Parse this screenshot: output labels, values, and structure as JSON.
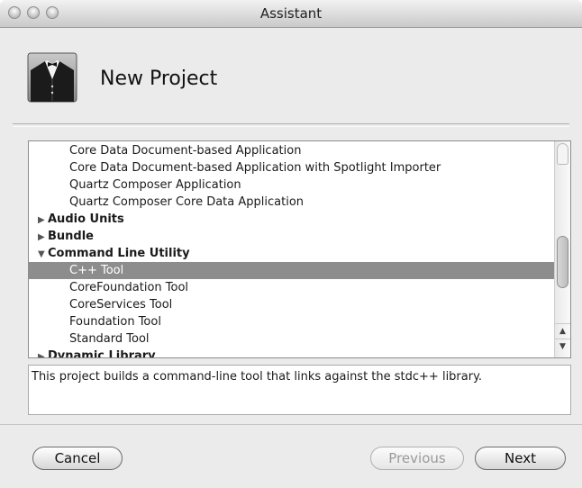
{
  "window": {
    "title": "Assistant"
  },
  "header": {
    "title": "New Project",
    "icon": "tuxedo-icon"
  },
  "list": {
    "items": [
      {
        "label": "Core Data Document-based Application",
        "kind": "child"
      },
      {
        "label": "Core Data Document-based Application with Spotlight Importer",
        "kind": "child"
      },
      {
        "label": "Quartz Composer Application",
        "kind": "child"
      },
      {
        "label": "Quartz Composer Core Data Application",
        "kind": "child"
      },
      {
        "label": "Audio Units",
        "kind": "group",
        "expanded": false
      },
      {
        "label": "Bundle",
        "kind": "group",
        "expanded": false
      },
      {
        "label": "Command Line Utility",
        "kind": "group",
        "expanded": true
      },
      {
        "label": "C++ Tool",
        "kind": "child",
        "selected": true
      },
      {
        "label": "CoreFoundation Tool",
        "kind": "child"
      },
      {
        "label": "CoreServices Tool",
        "kind": "child"
      },
      {
        "label": "Foundation Tool",
        "kind": "child"
      },
      {
        "label": "Standard Tool",
        "kind": "child"
      },
      {
        "label": "Dynamic Library",
        "kind": "group",
        "expanded": false
      }
    ]
  },
  "description": "This project builds a command-line tool that links against the stdc++ library.",
  "buttons": {
    "cancel": "Cancel",
    "previous": "Previous",
    "next": "Next"
  }
}
